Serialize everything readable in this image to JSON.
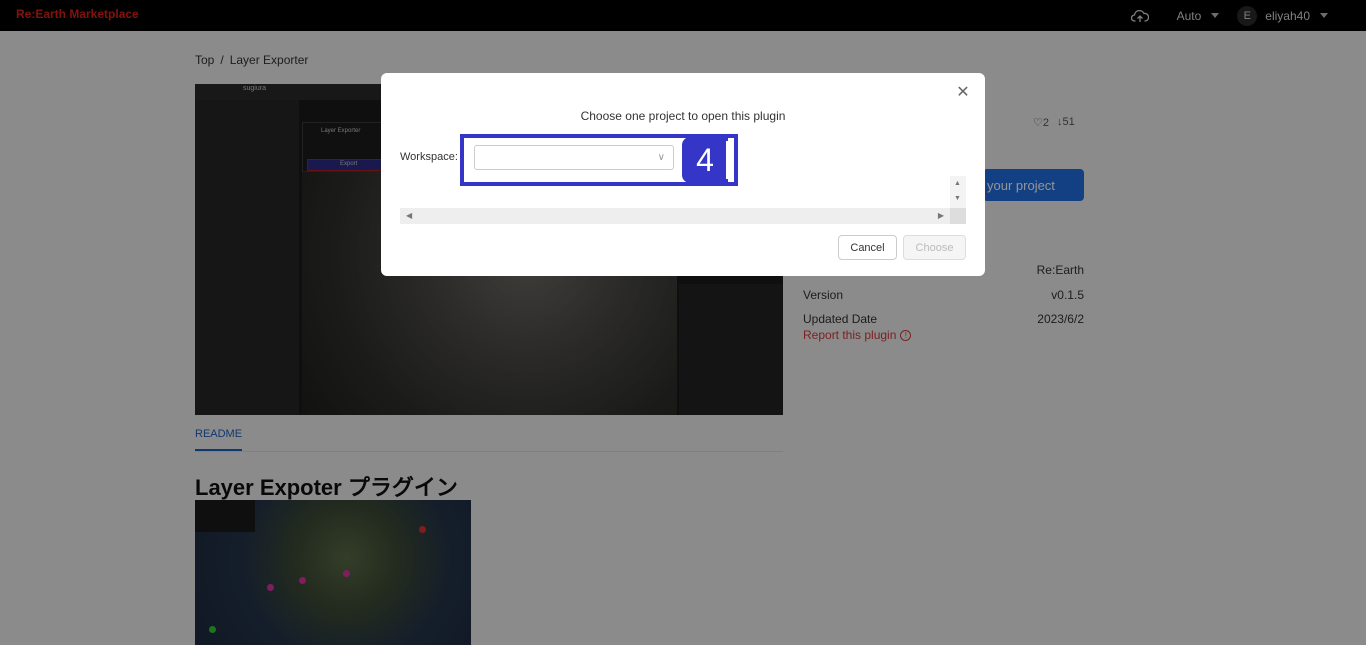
{
  "header": {
    "brand": "Re:Earth Marketplace",
    "theme": "Auto",
    "avatar_initial": "E",
    "username": "eliyah40"
  },
  "breadcrumb": {
    "home": "Top",
    "separator": "/",
    "current": "Layer Exporter"
  },
  "hero_image": {
    "workspace_name": "sugiura",
    "plugin_panel_title": "Layer Exporter",
    "export_label": "Export"
  },
  "tabs": {
    "readme": "README"
  },
  "readme": {
    "title": "Layer Expoter プラグイン"
  },
  "stats": {
    "likes": "2",
    "downloads": "51"
  },
  "open_button": "your project",
  "meta": {
    "author_value": "Re:Earth",
    "version_label": "Version",
    "version_value": "v0.1.5",
    "updated_label": "Updated Date",
    "updated_value": "2023/6/2",
    "report": "Report this plugin"
  },
  "modal": {
    "title": "Choose one project to open this plugin",
    "workspace_label": "Workspace:",
    "workspace_value": "",
    "badge": "4",
    "cancel": "Cancel",
    "choose": "Choose"
  },
  "colors": {
    "brand": "#e0201a",
    "primary": "#1f6fe0",
    "highlight": "#3535c8",
    "danger": "#d43a3a"
  }
}
